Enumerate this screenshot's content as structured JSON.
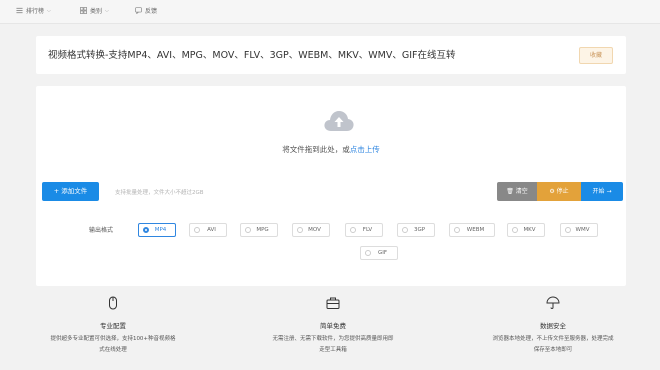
{
  "nav": {
    "rank_label": "排行榜",
    "category_label": "类别",
    "feedback_label": "反馈"
  },
  "header": {
    "title": "视频格式转换-支持MP4、AVI、MPG、MOV、FLV、3GP、WEBM、MKV、WMV、GIF在线互转",
    "favorite_label": "收藏"
  },
  "upload": {
    "drop_text": "将文件拖到此处，或",
    "drop_link": "点击上传",
    "add_file_label": "添加文件",
    "hint": "支持批量处理，文件大小不超过2GB",
    "clear_label": "清空",
    "stop_label": "停止",
    "start_label": "开始"
  },
  "formats": {
    "label": "输出格式",
    "selected": "MP4",
    "options": [
      "MP4",
      "AVI",
      "MPG",
      "MOV",
      "FLV",
      "3GP",
      "WEBM",
      "MKV",
      "WMV",
      "GIF"
    ]
  },
  "features": [
    {
      "icon": "mouse-icon",
      "title": "专业配置",
      "desc1": "提供超多专业配置可供选择，支持100+种音视频格",
      "desc2": "式在线处理"
    },
    {
      "icon": "toolbox-icon",
      "title": "简单免费",
      "desc1": "无需注册、无需下载软件，为您提供高质量即用即",
      "desc2": "走型工具箱"
    },
    {
      "icon": "umbrella-icon",
      "title": "数据安全",
      "desc1": "浏览器本地处理，不上传文件至服务器，处理完成",
      "desc2": "保存至本地即可"
    }
  ],
  "colors": {
    "primary": "#1a8be6",
    "warning": "#e3a23a",
    "neutral": "#888888"
  }
}
